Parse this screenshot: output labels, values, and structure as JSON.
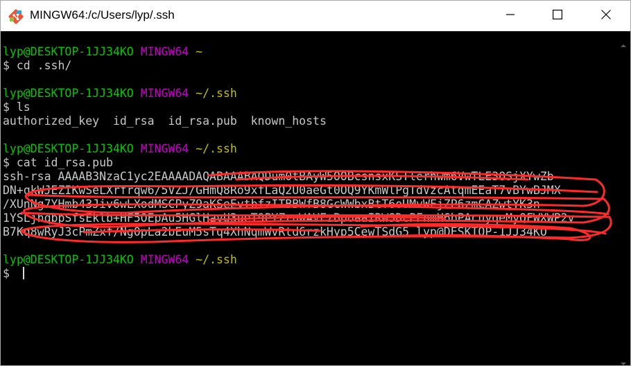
{
  "window": {
    "title": "MINGW64:/c/Users/lyp/.ssh",
    "icon": "git-bash-icon",
    "controls": [
      "minimize-icon",
      "maximize-icon",
      "close-icon"
    ]
  },
  "terminal": {
    "colors": {
      "background": "#000000",
      "user_host": "#00c800",
      "shell": "#c000c0",
      "path": "#c0c000",
      "text": "#c0c0c0",
      "redaction": "#ff2020"
    },
    "blocks": [
      {
        "prompt": {
          "user": "lyp@DESKTOP-1JJ34KO",
          "shell": "MINGW64",
          "path": "~"
        },
        "command": "$ cd .ssh/"
      },
      {
        "prompt": {
          "user": "lyp@DESKTOP-1JJ34KO",
          "shell": "MINGW64",
          "path": "~/.ssh"
        },
        "command": "$ ls",
        "output": "authorized_key  id_rsa  id_rsa.pub  known_hosts"
      },
      {
        "prompt": {
          "user": "lyp@DESKTOP-1JJ34KO",
          "shell": "MINGW64",
          "path": "~/.ssh"
        },
        "command": "$ cat id_rsa.pub",
        "output_lines": [
          "ssh-rsa AAAAB3NzaC1yc2EAAAADAQABAAABAQDum0tBAyW5OOBcsnsxKSTlerhwm6VwTLE3OSjXYwZb",
          "DN+qkWJEZIKwSeLXrfrqw6/5VZJ/GHmQ8Ro9xfLaQ2U0aeGt0OQ9YKmWlPgTdVzcAtqmEEaT7vBYwBJMX",
          "/XUnNg7YHmb43Jiv6wLXodMSCPyZ9aKSeEvtbfzITBBWfB8GcWWbxBtT6oUMvWFjZP6zmCAZwtYK3n",
          "1YSLjhqbpSfsEklb+HF5OEpAu5HGlHavU3ueT9PYZruWAVFzBpoaaIRWSDcPFnmH6bPAcuyqeMyQFWXWP2v",
          "B7Kq8wRyJ3cPmZxf/Ng0pLa2bEuM5sTq4XhNqmWvRtd6rzkHyp5CewTSdG5 lyp@DESKTOP-1JJ34KO"
        ]
      },
      {
        "prompt": {
          "user": "lyp@DESKTOP-1JJ34KO",
          "shell": "MINGW64",
          "path": "~/.ssh"
        },
        "command": "$ "
      }
    ]
  }
}
